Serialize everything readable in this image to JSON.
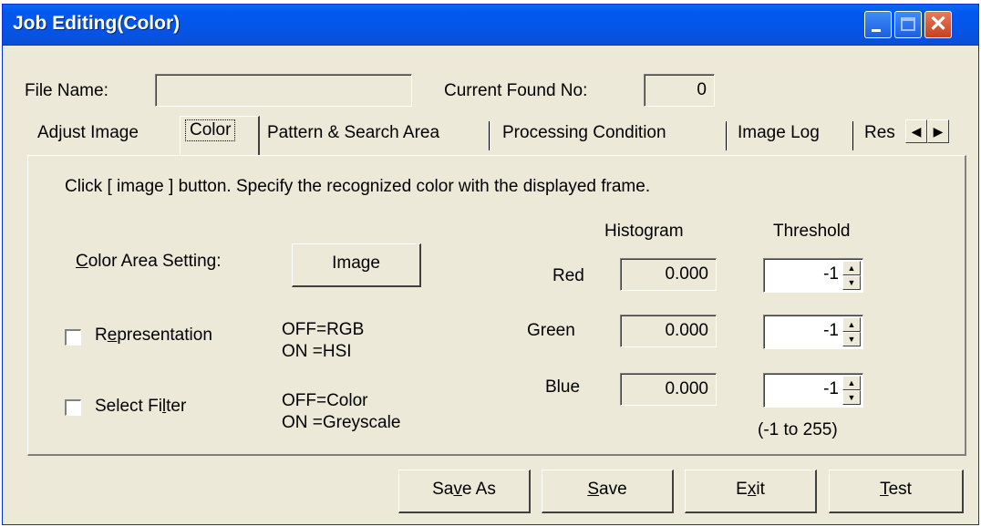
{
  "window": {
    "title": "Job Editing(Color)",
    "buttons": {
      "minimize": "minimize-icon",
      "maximize": "maximize-icon",
      "close": "close-icon"
    }
  },
  "header": {
    "file_name_label": "File Name:",
    "file_name_value": "",
    "current_found_label": "Current Found No:",
    "current_found_value": "0"
  },
  "tabs": [
    {
      "label": "Adjust Image"
    },
    {
      "label": "Color"
    },
    {
      "label": "Pattern & Search Area"
    },
    {
      "label": "Processing Condition"
    },
    {
      "label": "Image Log"
    },
    {
      "label": "Res"
    }
  ],
  "active_tab": "Color",
  "panel": {
    "instruction": "Click [ image ] button.  Specify the recognized color with the displayed frame.",
    "color_area_label": "Color Area Setting:",
    "image_button": "Image",
    "representation_label": "Representation",
    "representation_checked": false,
    "representation_note_off": "OFF=RGB",
    "representation_note_on": "ON =HSI",
    "select_filter_label": "Select Filter",
    "select_filter_checked": false,
    "select_filter_note_off": "OFF=Color",
    "select_filter_note_on": "ON =Greyscale",
    "histogram_header": "Histogram",
    "threshold_header": "Threshold",
    "channels": [
      {
        "name": "Red",
        "histogram": "0.000",
        "threshold": "-1"
      },
      {
        "name": "Green",
        "histogram": "0.000",
        "threshold": "-1"
      },
      {
        "name": "Blue",
        "histogram": "0.000",
        "threshold": "-1"
      }
    ],
    "threshold_range": "(-1 to 255)"
  },
  "footer": {
    "save_as": "Save As",
    "save": "Save",
    "exit": "Exit",
    "test": "Test"
  }
}
